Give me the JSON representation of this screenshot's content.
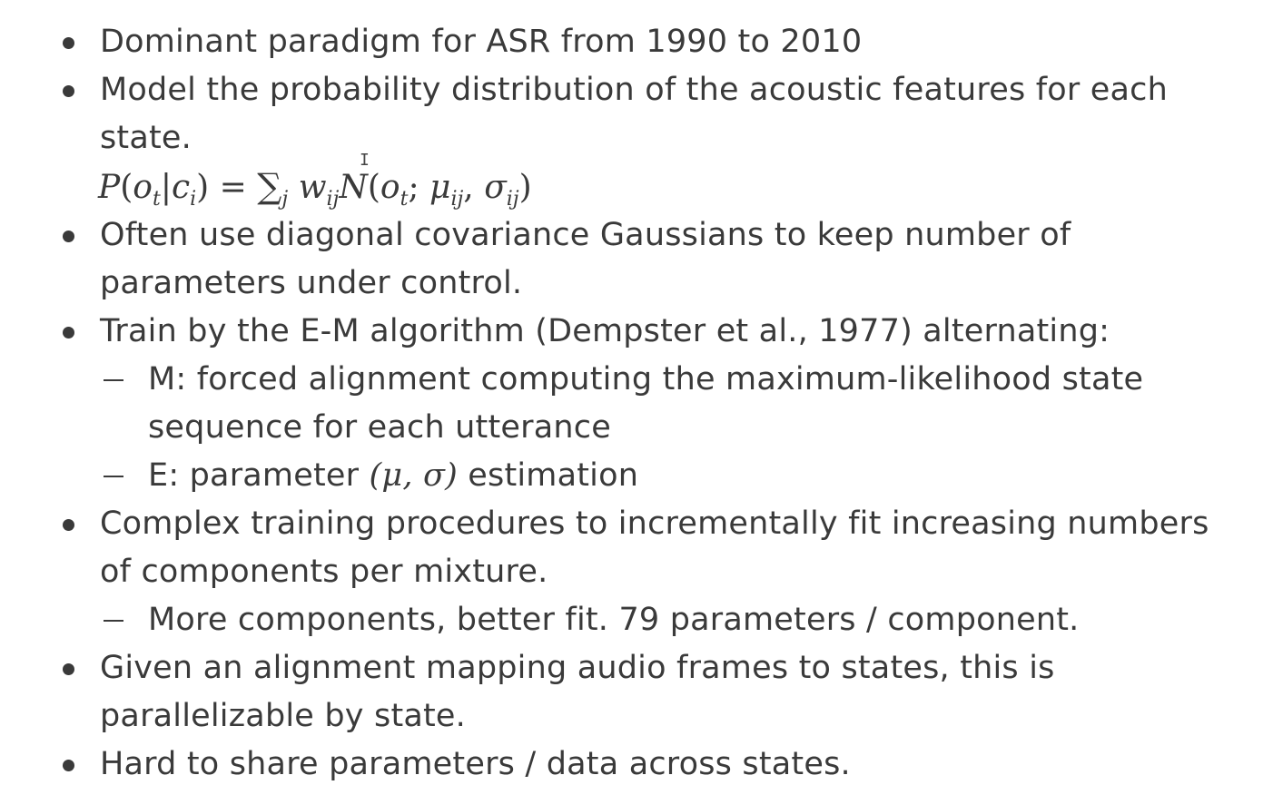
{
  "slide": {
    "b1": "Dominant paradigm for ASR from 1990 to 2010",
    "b2_l1": "Model the probability distribution of the acoustic features for each",
    "b2_l2": "state.",
    "formula": {
      "P": "P",
      "open": "(",
      "o": "o",
      "t": "t",
      "bar": "|",
      "c": "c",
      "i": "i",
      "close_eq": ") = ",
      "sum": "∑",
      "j": "j",
      "w": " w",
      "ij": "ij",
      "N": "N",
      "open2": "(",
      "o2": "o",
      "t2": "t",
      "semi": "; ",
      "mu": "μ",
      "ij2": "ij",
      "comma": ", ",
      "sigma": "σ",
      "ij3": "ij",
      "close2": ")"
    },
    "b3_l1": "Often use diagonal covariance Gaussians to keep number of",
    "b3_l2": "parameters under control.",
    "b4": "Train by the E-M algorithm (Dempster et al., 1977) alternating:",
    "s1_l1": "M: forced alignment computing the maximum-likelihood state",
    "s1_l2": "sequence for each utterance",
    "s2_pre": "E: parameter ",
    "s2_math": "(μ, σ)",
    "s2_post": " estimation",
    "b5_l1": "Complex training procedures to incrementally fit increasing numbers",
    "b5_l2": "of components per mixture.",
    "s3": "More components, better fit. 79 parameters / component.",
    "b6_l1": "Given an alignment mapping audio frames to states, this is",
    "b6_l2": "parallelizable by state.",
    "b7": "Hard to share parameters / data across states."
  },
  "cursor_glyph": "I"
}
